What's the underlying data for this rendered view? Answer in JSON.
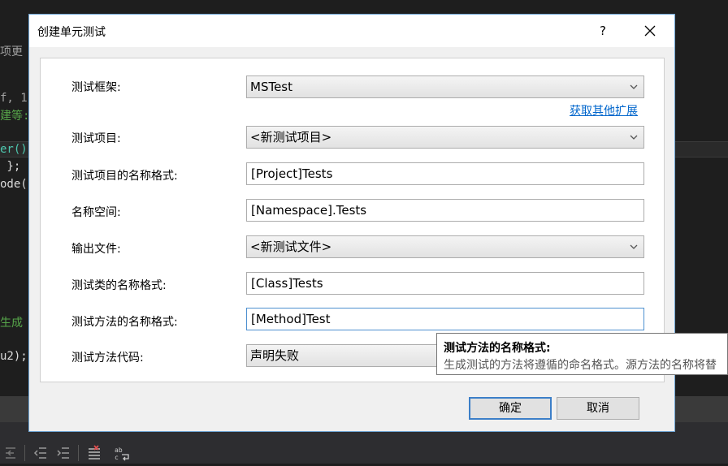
{
  "editor": {
    "lines": [
      {
        "text": "项更",
        "color": "#a0a0a0"
      },
      {
        "text": "f, 1",
        "color": "#a0a0a0"
      },
      {
        "text": "建等:",
        "color": "#57a64a"
      },
      {
        "text": "er()",
        "color": "#4ec9b0"
      },
      {
        "text": " };",
        "color": "#dcdcdc"
      },
      {
        "text": "ode()",
        "color": "#dcdcdc"
      },
      {
        "text": "生成",
        "color": "#57a64a"
      },
      {
        "text": "u2);",
        "color": "#dcdcdc"
      }
    ],
    "toolbar_icons": [
      "outdent-icon",
      "outdent-icon",
      "indent-icon",
      "uncomment-icon",
      "word-wrap-icon"
    ]
  },
  "dialog": {
    "title": "创建单元测试",
    "help": "?",
    "fields": {
      "framework": {
        "label": "测试框架:",
        "value": "MSTest"
      },
      "other_extensions_link": "获取其他扩展",
      "project": {
        "label": "测试项目:",
        "value": "<新测试项目>"
      },
      "project_name_format": {
        "label": "测试项目的名称格式:",
        "value": "[Project]Tests"
      },
      "namespace": {
        "label": "名称空间:",
        "value": "[Namespace].Tests"
      },
      "output_file": {
        "label": "输出文件:",
        "value": "<新测试文件>"
      },
      "class_name_format": {
        "label": "测试类的名称格式:",
        "value": "[Class]Tests"
      },
      "method_name_format": {
        "label": "测试方法的名称格式:",
        "value": "[Method]Test"
      },
      "method_code": {
        "label": "测试方法代码:",
        "value": "声明失败"
      }
    },
    "buttons": {
      "ok": "确定",
      "cancel": "取消"
    },
    "tooltip": {
      "title": "测试方法的名称格式:",
      "body": "生成测试的方法将遵循的命名格式。源方法的名称将替"
    }
  },
  "colors": {
    "accent": "#3c7fc8",
    "link": "#0066cc",
    "editor_bg": "#1e1e1e"
  }
}
